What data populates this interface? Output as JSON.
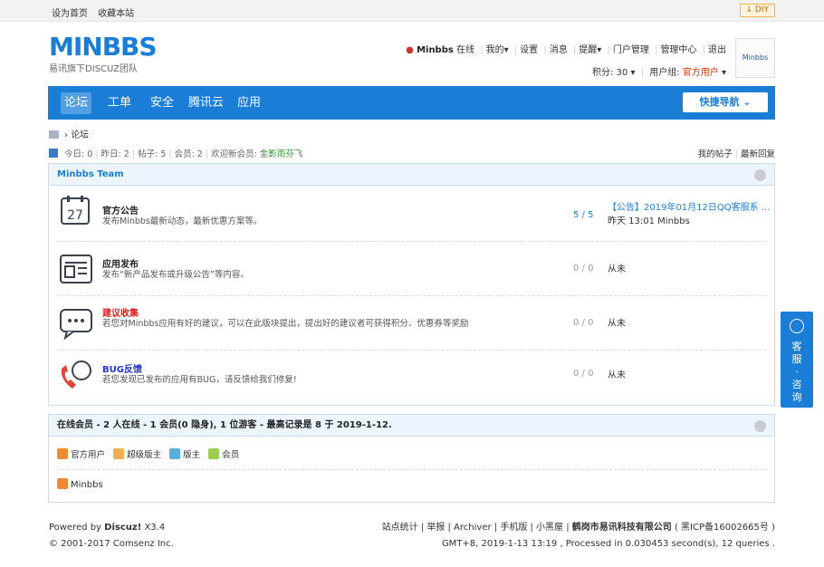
{
  "topbar": {
    "set_home": "设为首页",
    "bookmark": "收藏本站",
    "diy": "DIY"
  },
  "logo": {
    "text": "MINBBS",
    "subtitle": "易讯旗下DISCUZ团队"
  },
  "user": {
    "name": "Minbbs",
    "status": "在线",
    "links": [
      "我的",
      "设置",
      "消息",
      "提醒",
      "门户管理",
      "管理中心",
      "退出"
    ],
    "points_label": "积分: 30",
    "group_label": "用户组:",
    "group": "官方用户",
    "avatar_text": "Minbbs"
  },
  "nav": {
    "items": [
      "论坛",
      "工单",
      "安全",
      "腾讯云",
      "应用"
    ],
    "quick_nav": "快捷导航"
  },
  "breadcrumb": {
    "current": "论坛"
  },
  "stats": {
    "text_today": "今日: 0",
    "text_yesterday": "昨日: 2",
    "text_posts": "帖子: 5",
    "text_members": "会员: 2",
    "welcome": "欢迎新会员:",
    "newest_member": "金影雨芬飞",
    "my_posts": "我的帖子",
    "latest_replies": "最新回复"
  },
  "category": {
    "title": "Minbbs Team"
  },
  "forums": [
    {
      "name": "官方公告",
      "name_color": "#222222",
      "desc": "发布Minbbs最新动态，最新优惠方案等。",
      "count": "5 / 5",
      "last_title": "【公告】2019年01月12日QQ客服系 ...",
      "last_meta": "昨天 13:01 Minbbs",
      "icon": "calendar-icon",
      "icon_num": "27"
    },
    {
      "name": "应用发布",
      "name_color": "#222222",
      "desc": "发布“新产品发布或升级公告”等内容。",
      "count": "0 / 0",
      "last_title": "从未",
      "last_meta": "",
      "icon": "release-icon"
    },
    {
      "name": "建议收集",
      "name_color": "#e02020",
      "desc": "若您对Minbbs应用有好的建议，可以在此版块提出，提出好的建议者可获得积分、优惠券等奖励",
      "count": "0 / 0",
      "last_title": "从未",
      "last_meta": "",
      "icon": "chat-bubble-icon"
    },
    {
      "name": "BUG反馈",
      "name_color": "#2233cc",
      "desc": "若您发现已发布的应用有BUG，请反馈给我们修复!",
      "count": "0 / 0",
      "last_title": "从未",
      "last_meta": "",
      "icon": "phone-icon"
    }
  ],
  "online": {
    "title": "在线会员 - 2 人在线 - 1 会员(0 隐身), 1 位游客 - 最高记录是 8 于 2019-1-12.",
    "legend": [
      "官方用户",
      "超级版主",
      "版主",
      "会员"
    ],
    "member": "Minbbs"
  },
  "side_button": {
    "label1": "客服",
    "dot": "·",
    "label2": "咨询"
  },
  "footer": {
    "powered": "Powered by",
    "brand": "Discuz!",
    "version": "X3.4",
    "copyright": "© 2001-2017 Comsenz Inc.",
    "links": "站点统计 | 举报 | Archiver | 手机版 | 小黑屋 |",
    "company": "鹤岗市易讯科技有限公司",
    "icp": "( 黑ICP备16002665号 )",
    "time_info": "GMT+8, 2019-1-13 13:19 , Processed in 0.030453 second(s), 12 queries ."
  }
}
